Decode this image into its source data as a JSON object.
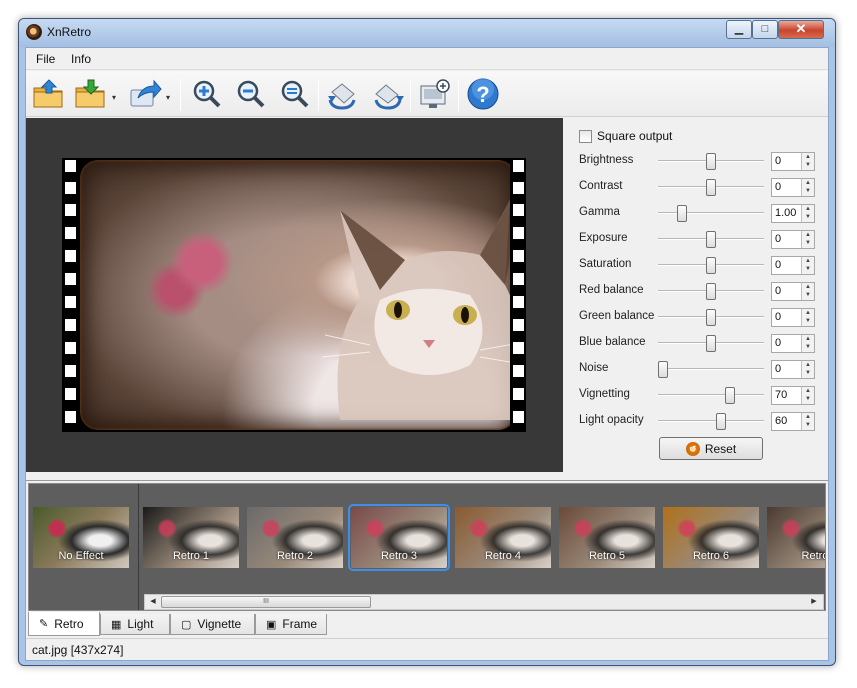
{
  "window": {
    "title": "XnRetro",
    "min_glyph": "▁",
    "max_glyph": "□",
    "close_glyph": "✕"
  },
  "menu": {
    "items": [
      "File",
      "Info"
    ]
  },
  "toolbar": {
    "buttons": [
      "open-icon",
      "save-icon",
      "share-icon",
      "zoom-in-icon",
      "zoom-out-icon",
      "zoom-fit-icon",
      "rotate-left-icon",
      "rotate-right-icon",
      "wallpaper-icon",
      "help-icon"
    ],
    "dropdown_glyph": "▾",
    "help_glyph": "?"
  },
  "settings": {
    "square_output_label": "Square output",
    "square_output_checked": false,
    "params": [
      {
        "label": "Brightness",
        "value": "0",
        "fraction": 0.5
      },
      {
        "label": "Contrast",
        "value": "0",
        "fraction": 0.5
      },
      {
        "label": "Gamma",
        "value": "1.00",
        "fraction": 0.2
      },
      {
        "label": "Exposure",
        "value": "0",
        "fraction": 0.5
      },
      {
        "label": "Saturation",
        "value": "0",
        "fraction": 0.5
      },
      {
        "label": "Red balance",
        "value": "0",
        "fraction": 0.5
      },
      {
        "label": "Green balance",
        "value": "0",
        "fraction": 0.5
      },
      {
        "label": "Blue balance",
        "value": "0",
        "fraction": 0.5
      },
      {
        "label": "Noise",
        "value": "0",
        "fraction": 0.0
      },
      {
        "label": "Vignetting",
        "value": "70",
        "fraction": 0.7
      },
      {
        "label": "Light opacity",
        "value": "60",
        "fraction": 0.6
      }
    ],
    "spin_up_glyph": "▲",
    "spin_down_glyph": "▼",
    "reset_label": "Reset",
    "reset_glyph": "↺"
  },
  "presets": {
    "no_effect_label": "No Effect",
    "items": [
      {
        "label": "Retro 1",
        "selected": false,
        "tint": "#1a1a1a"
      },
      {
        "label": "Retro 2",
        "selected": false,
        "tint": "#6a6a6a"
      },
      {
        "label": "Retro 3",
        "selected": true,
        "tint": "#7a4a4a"
      },
      {
        "label": "Retro 4",
        "selected": false,
        "tint": "#8a5a30"
      },
      {
        "label": "Retro 5",
        "selected": false,
        "tint": "#6a4a3a"
      },
      {
        "label": "Retro 6",
        "selected": false,
        "tint": "#b0701a"
      },
      {
        "label": "Retro",
        "selected": false,
        "tint": "#4a3a30"
      }
    ],
    "scroll_left_glyph": "◀",
    "scroll_right_glyph": "▶",
    "scroll_grip": "III"
  },
  "tabs": [
    {
      "label": "Retro",
      "icon": "✎",
      "active": true
    },
    {
      "label": "Light",
      "icon": "▦",
      "active": false
    },
    {
      "label": "Vignette",
      "icon": "▢",
      "active": false
    },
    {
      "label": "Frame",
      "icon": "▣",
      "active": false
    }
  ],
  "status": {
    "text": "cat.jpg [437x274]"
  },
  "colors": {
    "accent": "#3e8eea",
    "preview_bg": "#383838",
    "presets_bg": "#5e5e5e"
  }
}
